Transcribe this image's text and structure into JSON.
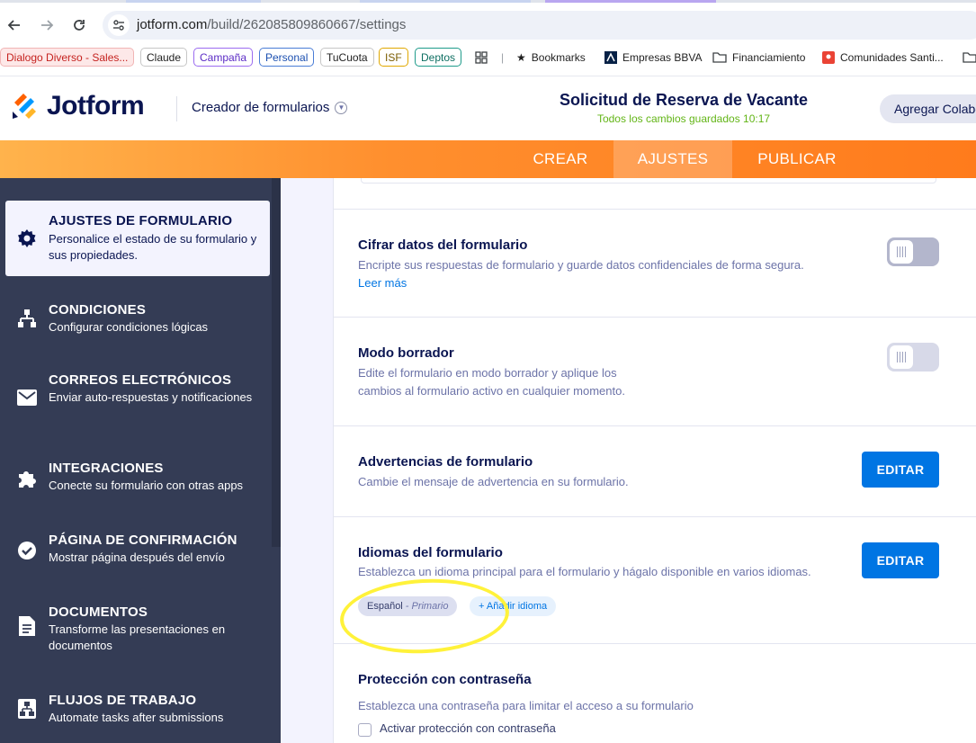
{
  "browser": {
    "url_host": "jotform.com",
    "url_path": "/build/262085809860667/settings",
    "bookmarks": [
      {
        "label": "Dialogo Diverso - Sales..."
      },
      {
        "label": "Claude"
      },
      {
        "label": "Campaña"
      },
      {
        "label": "Personal"
      },
      {
        "label": "TuCuota"
      },
      {
        "label": "ISF"
      },
      {
        "label": "Deptos"
      },
      {
        "label": "Bookmarks"
      },
      {
        "label": "Empresas BBVA"
      },
      {
        "label": "Financiamiento"
      },
      {
        "label": "Comunidades Santi..."
      }
    ]
  },
  "header": {
    "logo_text": "Jotform",
    "builder_menu": "Creador de formularios",
    "form_title": "Solicitud de Reserva de Vacante",
    "save_status": "Todos los cambios guardados 10:17",
    "add_collaborator": "Agregar Colaborador"
  },
  "nav": {
    "tabs": [
      {
        "label": "CREAR"
      },
      {
        "label": "AJUSTES"
      },
      {
        "label": "PUBLICAR"
      }
    ],
    "active_tab": "AJUSTES"
  },
  "sidebar": {
    "items": [
      {
        "title": "AJUSTES DE FORMULARIO",
        "desc": "Personalice el estado de su formulario y sus propiedades.",
        "icon": "gear-icon"
      },
      {
        "title": "CONDICIONES",
        "desc": "Configurar condiciones lógicas",
        "icon": "conditions-icon"
      },
      {
        "title": "CORREOS ELECTRÓNICOS",
        "desc": "Enviar auto-respuestas y notificaciones",
        "icon": "mail-icon"
      },
      {
        "title": "INTEGRACIONES",
        "desc": "Conecte su formulario con otras apps",
        "icon": "puzzle-icon"
      },
      {
        "title": "PÁGINA DE CONFIRMACIÓN",
        "desc": "Mostrar página después del envío",
        "icon": "check-circle-icon"
      },
      {
        "title": "DOCUMENTOS",
        "desc": "Transforme las presentaciones en documentos",
        "icon": "document-icon"
      },
      {
        "title": "FLUJOS DE TRABAJO",
        "desc": "Automate tasks after submissions",
        "icon": "workflow-icon"
      }
    ]
  },
  "settings": {
    "encrypt": {
      "title": "Cifrar datos del formulario",
      "desc": "Encripte sus respuestas de formulario y guarde datos confidenciales de forma segura.",
      "link": "Leer más",
      "enabled": false
    },
    "draft": {
      "title": "Modo borrador",
      "desc_line1": "Edite el formulario en modo borrador y aplique los",
      "desc_line2": "cambios al formulario activo en cualquier momento.",
      "enabled": false
    },
    "warnings": {
      "title": "Advertencias de formulario",
      "desc": "Cambie el mensaje de advertencia en su formulario.",
      "button": "EDITAR"
    },
    "languages": {
      "title": "Idiomas del formulario",
      "desc": "Establezca un idioma principal para el formulario y hágalo disponible en varios idiomas.",
      "button": "EDITAR",
      "primary_language": "Español",
      "primary_suffix": "- Primario",
      "add_language": "+ Añadir idioma"
    },
    "password": {
      "title": "Protección con contraseña",
      "desc": "Establezca una contraseña para limitar el acceso a su formulario",
      "checkbox_label": "Activar protección con contraseña",
      "checked": false
    }
  },
  "colors": {
    "brand_orange": "#ff7b1c",
    "sidebar_bg": "#343c55",
    "primary_blue": "#0075e3",
    "saved_green": "#63b517",
    "annotation_yellow": "#fff23a"
  }
}
